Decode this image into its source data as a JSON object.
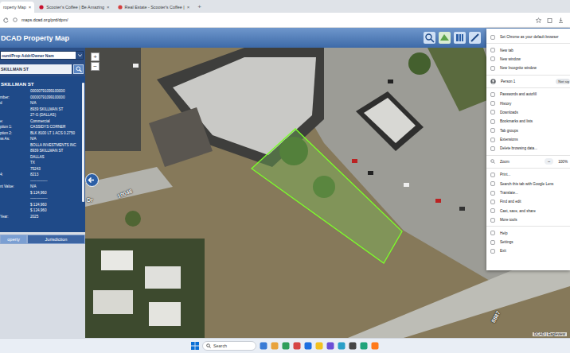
{
  "browser": {
    "tabs": [
      {
        "label": "roperty Map",
        "close": "×",
        "selected": true
      },
      {
        "label": "Scooter's Coffee | Be Amazing",
        "close": "×",
        "selected": false
      },
      {
        "label": "Real Estate - Scooter's Coffee |",
        "close": "×",
        "selected": false
      }
    ],
    "new_tab": "+",
    "address": "maps.dcad.org/prd/dpm/"
  },
  "app": {
    "title": "DCAD Property Map"
  },
  "search": {
    "mode": "ount/Prop Addr/Owner Nam",
    "query": "SKILLMAN ST"
  },
  "details": {
    "heading": "SKILLMAN ST",
    "rows": [
      {
        "label": "",
        "value": "00000791099100000"
      },
      {
        "label": "mber:",
        "value": "00000791099100000"
      },
      {
        "label": "d",
        "value": "N/A"
      },
      {
        "label": "",
        "value": "8939 SKILLMAN ST"
      },
      {
        "label": "",
        "value": "27-G (DALLAS)"
      },
      {
        "label": "e:",
        "value": "Commercial"
      },
      {
        "label": "ption 1:",
        "value": "CASSIDYS CORNER"
      },
      {
        "label": "ption 2:",
        "value": "BLK 8100 LT 1 ACS 0.2750"
      },
      {
        "label": "ss As:",
        "value": "N/A"
      },
      {
        "label": "",
        "value": "BOLLA INVESTMENTS INC"
      },
      {
        "label": "",
        "value": "8939 SKILLMAN ST"
      },
      {
        "label": "",
        "value": "DALLAS"
      },
      {
        "label": "",
        "value": "TX"
      },
      {
        "label": "",
        "value": "75243"
      },
      {
        "label": "4:",
        "value": "8213"
      },
      {
        "label": "",
        "value": "--------------"
      },
      {
        "label": "nt Value:",
        "value": "N/A"
      },
      {
        "label": "",
        "value": "$ 124,960"
      },
      {
        "label": "",
        "value": "--------------"
      },
      {
        "label": "",
        "value": "$ 124,960"
      },
      {
        "label": "",
        "value": "$ 124,960"
      },
      {
        "label": "Year:",
        "value": "2025"
      }
    ]
  },
  "panel_tabs": [
    {
      "label": "operty",
      "selected": true
    },
    {
      "label": "Jurisdiction",
      "selected": false
    }
  ],
  "map": {
    "zoom_in": "+",
    "zoom_out": "−",
    "labels": [
      {
        "text": "10048"
      },
      {
        "text": "Dr"
      },
      {
        "text": "8887"
      }
    ],
    "attribution": "DCAD | Eagleview"
  },
  "menu": {
    "groups": [
      [
        {
          "label": "Set Chrome as your default browser"
        }
      ],
      [
        {
          "label": "New tab"
        },
        {
          "label": "New window"
        },
        {
          "label": "New Incognito window"
        }
      ],
      [
        {
          "label": "Person 1",
          "badge": "Not sig"
        }
      ],
      [
        {
          "label": "Passwords and autofill"
        },
        {
          "label": "History"
        },
        {
          "label": "Downloads"
        },
        {
          "label": "Bookmarks and lists"
        },
        {
          "label": "Tab groups"
        },
        {
          "label": "Extensions"
        },
        {
          "label": "Delete browsing data..."
        }
      ],
      [
        {
          "label": "Zoom",
          "minus": "−",
          "value": "100%"
        }
      ],
      [
        {
          "label": "Print..."
        },
        {
          "label": "Search this tab with Google Lens"
        },
        {
          "label": "Translate..."
        },
        {
          "label": "Find and edit"
        },
        {
          "label": "Cast, save, and share"
        },
        {
          "label": "More tools"
        }
      ],
      [
        {
          "label": "Help"
        },
        {
          "label": "Settings"
        },
        {
          "label": "Exit"
        }
      ]
    ]
  },
  "taskbar": {
    "search": "Search"
  }
}
